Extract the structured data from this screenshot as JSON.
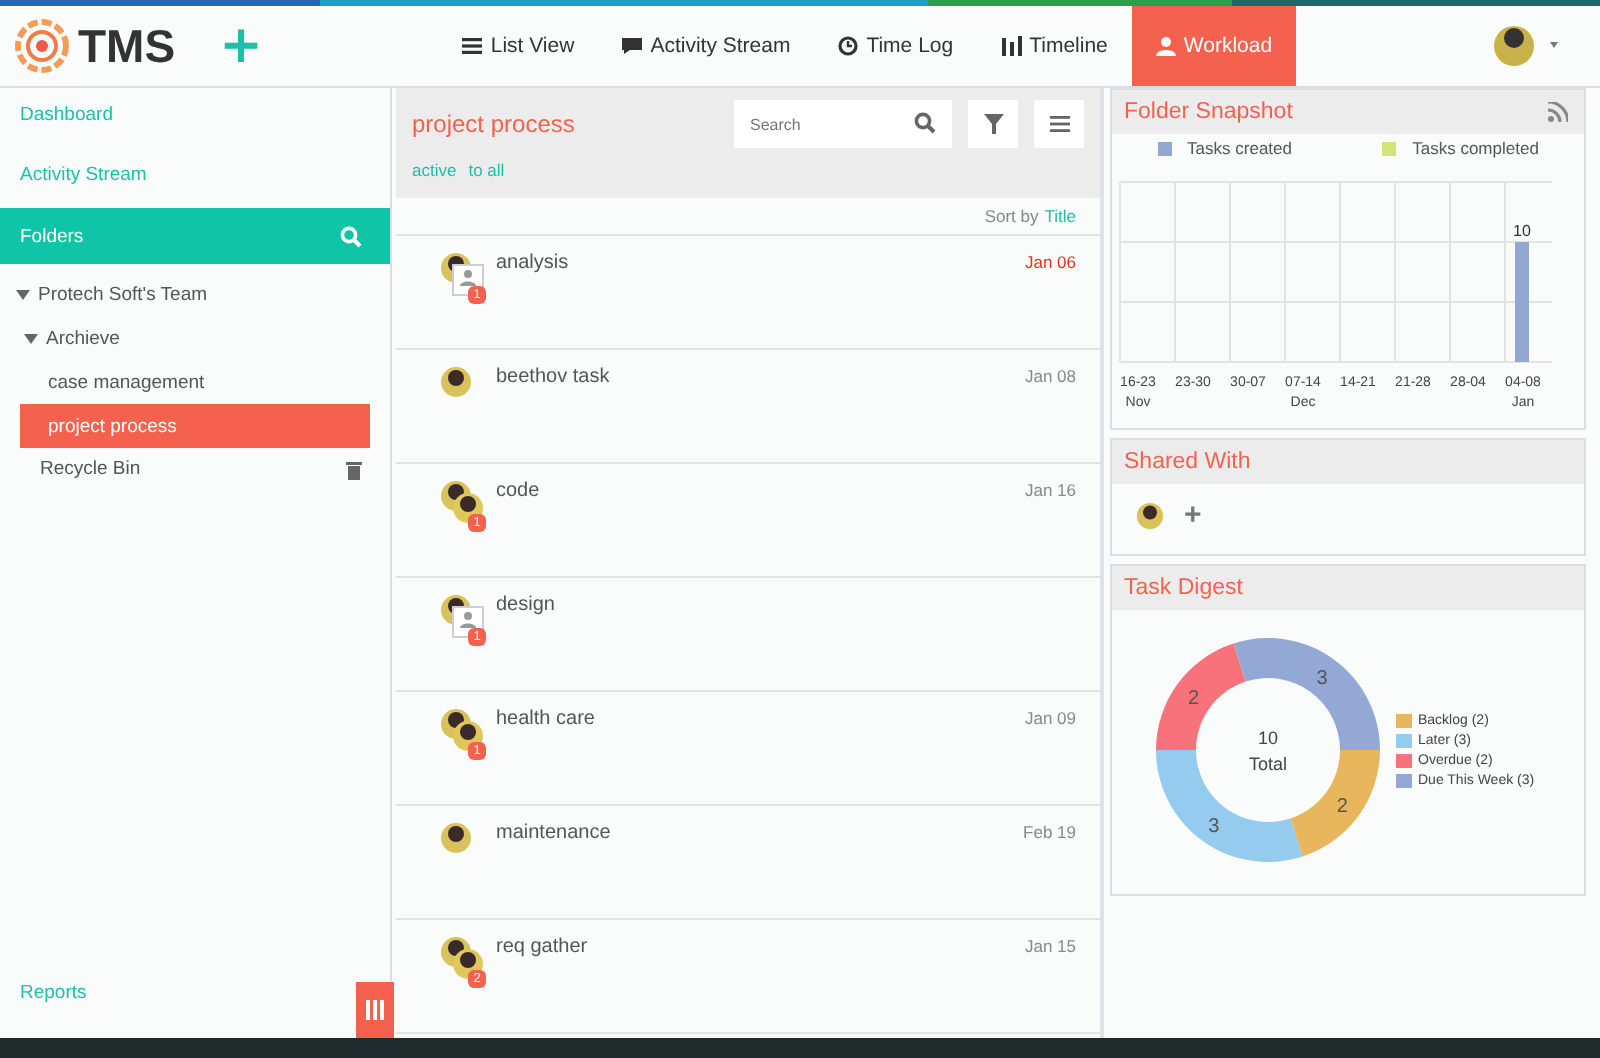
{
  "topbar": {
    "logo": "TMS",
    "add_symbol": "+",
    "nav": [
      {
        "label": "List View",
        "selected": false
      },
      {
        "label": "Activity Stream",
        "selected": false
      },
      {
        "label": "Time Log",
        "selected": false
      },
      {
        "label": "Timeline",
        "selected": false
      },
      {
        "label": "Workload",
        "selected": true
      }
    ]
  },
  "sidebar": {
    "links": [
      "Dashboard",
      "Activity Stream"
    ],
    "folders_title": "Folders",
    "tree": [
      {
        "label": "Protech Soft's Team",
        "expanded": true,
        "selected": false,
        "children": [
          {
            "label": "Archieve",
            "expanded": true,
            "selected": false,
            "children": [
              {
                "label": "case management",
                "selected": false
              },
              {
                "label": "project process",
                "selected": true
              }
            ]
          }
        ]
      }
    ],
    "recycle_bin": "Recycle Bin",
    "footer_link": "Reports"
  },
  "task_list": {
    "title": "project process",
    "search": {
      "placeholder": "Search"
    },
    "filters": [
      "active",
      "to all"
    ],
    "sort_prefix": "Sort by",
    "sort_field": "Title",
    "tasks": [
      {
        "title": "analysis",
        "date": "Jan 06",
        "overdue": true,
        "kind": "pair_placeholder",
        "badge": "1"
      },
      {
        "title": "beethov task",
        "date": "Jan 08",
        "overdue": false,
        "kind": "single"
      },
      {
        "title": "code",
        "date": "Jan 16",
        "overdue": false,
        "kind": "pair",
        "badge": "1"
      },
      {
        "title": "design",
        "kind": "pair_placeholder",
        "badge": "1"
      },
      {
        "title": "health care",
        "date": "Jan 09",
        "overdue": false,
        "kind": "pair",
        "badge": "1"
      },
      {
        "title": "maintenance",
        "date": "Feb 19",
        "overdue": false,
        "kind": "single"
      },
      {
        "title": "req gather",
        "date": "Jan 15",
        "overdue": false,
        "kind": "pair",
        "badge": "2"
      }
    ]
  },
  "snapshot": {
    "title": "Folder Snapshot",
    "months": [
      "Nov",
      "Dec",
      "Jan"
    ],
    "chart_data": {
      "type": "bar",
      "categories": [
        "16-23",
        "23-30",
        "30-07",
        "07-14",
        "14-21",
        "21-28",
        "28-04",
        "04-08"
      ],
      "series": [
        {
          "name": "Tasks created",
          "color": "#92a8d1",
          "values": [
            null,
            null,
            null,
            null,
            null,
            null,
            null,
            10
          ]
        },
        {
          "name": "Tasks completed",
          "color": "#d4e27a",
          "values": [
            null,
            null,
            null,
            null,
            null,
            null,
            null,
            null
          ]
        }
      ],
      "data_labels": true
    }
  },
  "shared": {
    "title": "Shared With",
    "add_symbol": "+"
  },
  "digest": {
    "title": "Task Digest",
    "center_value": "10",
    "center_label": "Total",
    "chart_data": {
      "type": "donut",
      "categories": [
        "Backlog (2)",
        "Later (3)",
        "Overdue (2)",
        "Due This Week (3)"
      ],
      "values": [
        2,
        3,
        2,
        3
      ],
      "colors": [
        "#e8b75d",
        "#94cbee",
        "#f7727a",
        "#93a8d4"
      ],
      "data_labels": true,
      "legend": "right"
    }
  }
}
